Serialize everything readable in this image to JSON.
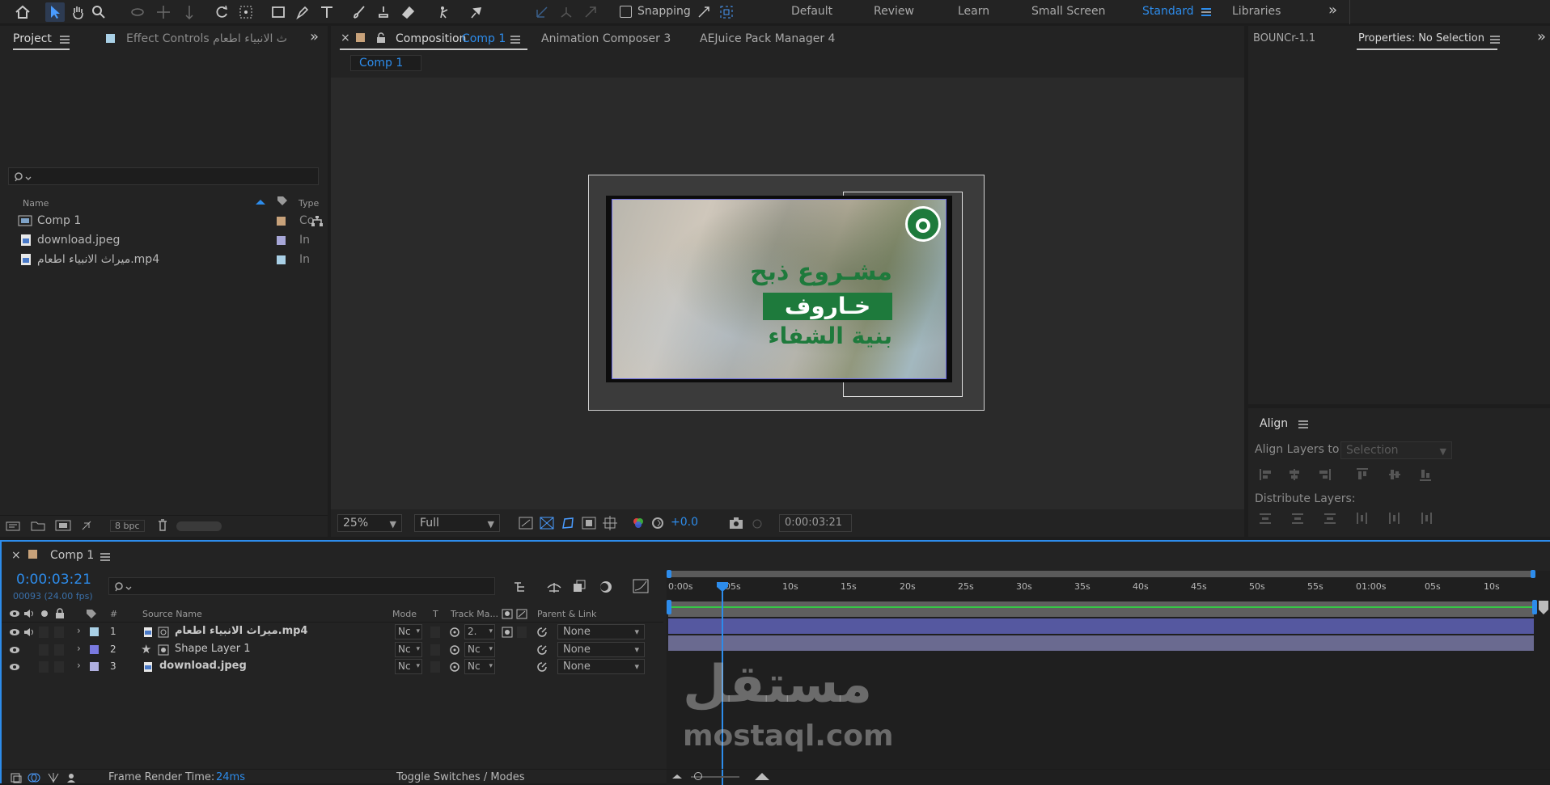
{
  "toolbar": {
    "snapping_label": "Snapping",
    "workspaces": [
      "Default",
      "Review",
      "Learn",
      "Small Screen",
      "Standard",
      "Libraries"
    ],
    "active_workspace": "Standard"
  },
  "project_panel": {
    "tab_project": "Project",
    "tab_effect_controls": "Effect Controls ميراث الانبياء اطعام",
    "col_name": "Name",
    "col_type": "Type",
    "items": [
      {
        "name": "Comp 1",
        "type": "Co",
        "color": "#c8a27a"
      },
      {
        "name": "download.jpeg",
        "type": "In",
        "color": "#a7a7d8"
      },
      {
        "name": "ميراث الانبياء اطعام.mp4",
        "type": "In",
        "color": "#a9d0e6"
      }
    ],
    "bpc": "8 bpc"
  },
  "composition_panel": {
    "tab_label": "Composition",
    "tab_comp": "Comp 1",
    "tab_animation_composer": "Animation Composer 3",
    "tab_aejuice": "AEJuice Pack Manager 4",
    "breadcrumb": "Comp 1",
    "zoom": "25%",
    "resolution": "Full",
    "exposure": "+0.0",
    "timecode": "0:00:03:21",
    "preview_text": {
      "line1": "مشـروع ذبح",
      "line2": "خـاروف",
      "line3": "بنية الشفاء"
    }
  },
  "right_panels": {
    "tab_bouncr": "BOUNCr-1.1",
    "tab_properties": "Properties: No Selection",
    "align_title": "Align",
    "align_layers_to": "Align Layers to:",
    "align_select_value": "Selection",
    "distribute_layers": "Distribute Layers:"
  },
  "timeline": {
    "tab_label": "Comp 1",
    "current_time": "0:00:03:21",
    "frame_info": "00093 (24.00 fps)",
    "headers": {
      "num": "#",
      "source_name": "Source Name",
      "mode": "Mode",
      "t": "T",
      "track_matte": "Track Ma...",
      "parent_link": "Parent & Link"
    },
    "layers": [
      {
        "num": "1",
        "name": "ميراث الانبياء اطعام.mp4",
        "mode": "Nc",
        "track": "2.",
        "parent": "None",
        "color": "#a9d0e6",
        "bar_color": "#5f5f5f"
      },
      {
        "num": "2",
        "name": "Shape Layer 1",
        "mode": "Nc",
        "track": "Nc",
        "parent": "None",
        "color": "#7a7ae0",
        "bar_color": "#5558a0"
      },
      {
        "num": "3",
        "name": "download.jpeg",
        "mode": "Nc",
        "track": "Nc",
        "parent": "None",
        "color": "#b0b0e0",
        "bar_color": "#6a6a90"
      }
    ],
    "ruler_labels": [
      "0:00s",
      "05s",
      "10s",
      "15s",
      "20s",
      "25s",
      "30s",
      "35s",
      "40s",
      "45s",
      "50s",
      "55s",
      "01:00s",
      "05s",
      "10s"
    ],
    "frame_render_label": "Frame Render Time:",
    "frame_render_value": "24ms",
    "toggle_label": "Toggle Switches / Modes"
  },
  "watermark": {
    "arabic": "مستقل",
    "latin": "mostaql.com"
  },
  "colors": {
    "accent": "#2d8ceb",
    "panel_bg": "#232323",
    "green_badge": "#1e7a3c"
  }
}
